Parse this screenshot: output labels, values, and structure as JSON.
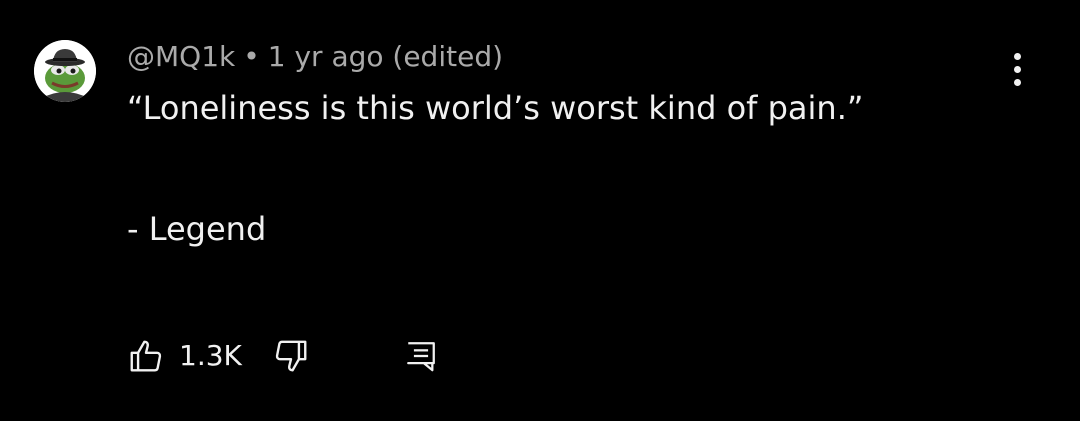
{
  "comment": {
    "author": "@MQ1k",
    "separator": "•",
    "time": "1 yr ago (edited)",
    "lines": [
      "“Loneliness is this world’s worst kind of pain.”",
      "- Legend"
    ]
  },
  "actions": {
    "like_count": "1.3K"
  },
  "icons": {
    "avatar": "pepe-frog-fedora-avatar",
    "more": "more-vert-icon",
    "like": "thumbs-up-icon",
    "dislike": "thumbs-down-icon",
    "reply": "reply-comment-icon"
  },
  "colors": {
    "background": "#000000",
    "primary_text": "#f1f1f1",
    "secondary_text": "#aaaaaa"
  }
}
